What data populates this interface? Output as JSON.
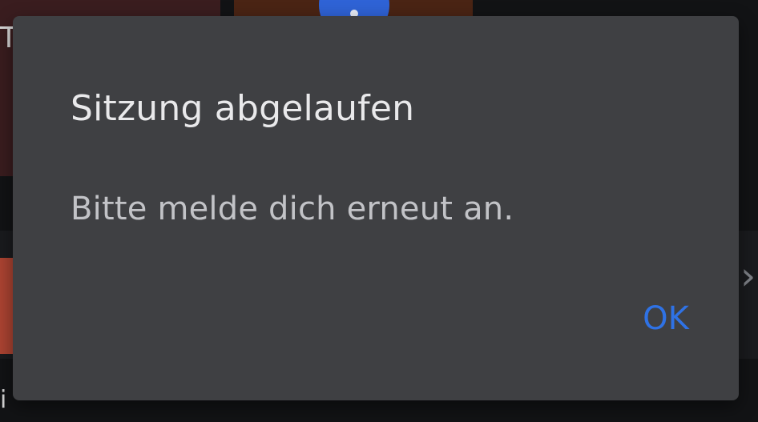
{
  "dialog": {
    "title": "Sitzung abgelaufen",
    "message": "Bitte melde dich erneut an.",
    "ok_label": "OK"
  },
  "background": {
    "chevron_icon": "chevron-right-icon"
  },
  "colors": {
    "dialog_bg": "#3f4043",
    "title_text": "#e9e9eb",
    "message_text": "#c2c3c7",
    "accent": "#2f72e5"
  }
}
